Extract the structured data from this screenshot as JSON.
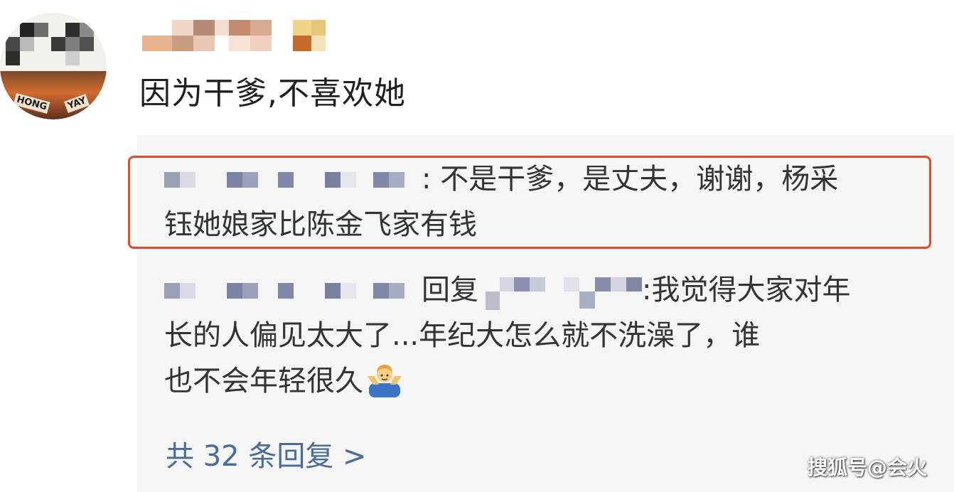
{
  "comment": {
    "text": "因为干爹,不喜欢她"
  },
  "replies": [
    {
      "separator": ":",
      "text_line1": " 不是干爹，是丈夫，谢谢，杨采",
      "text_line2": "钰她娘家比陈金飞家有钱"
    },
    {
      "reply_word": "回复",
      "separator": ":",
      "text_line1": "我觉得大家对年",
      "text_line2": "长的人偏见太大了...年纪大怎么就不洗澡了，谁",
      "text_line3": "也不会年轻很久"
    }
  ],
  "more_replies_label": "共 32 条回复 >",
  "watermark": "搜狐号@会火",
  "colors": {
    "highlight_border": "#e4492a",
    "link": "#4a6b99",
    "replies_background": "#f5f5f5"
  },
  "icons": {
    "emoji": "man-shrugging-emoji"
  }
}
